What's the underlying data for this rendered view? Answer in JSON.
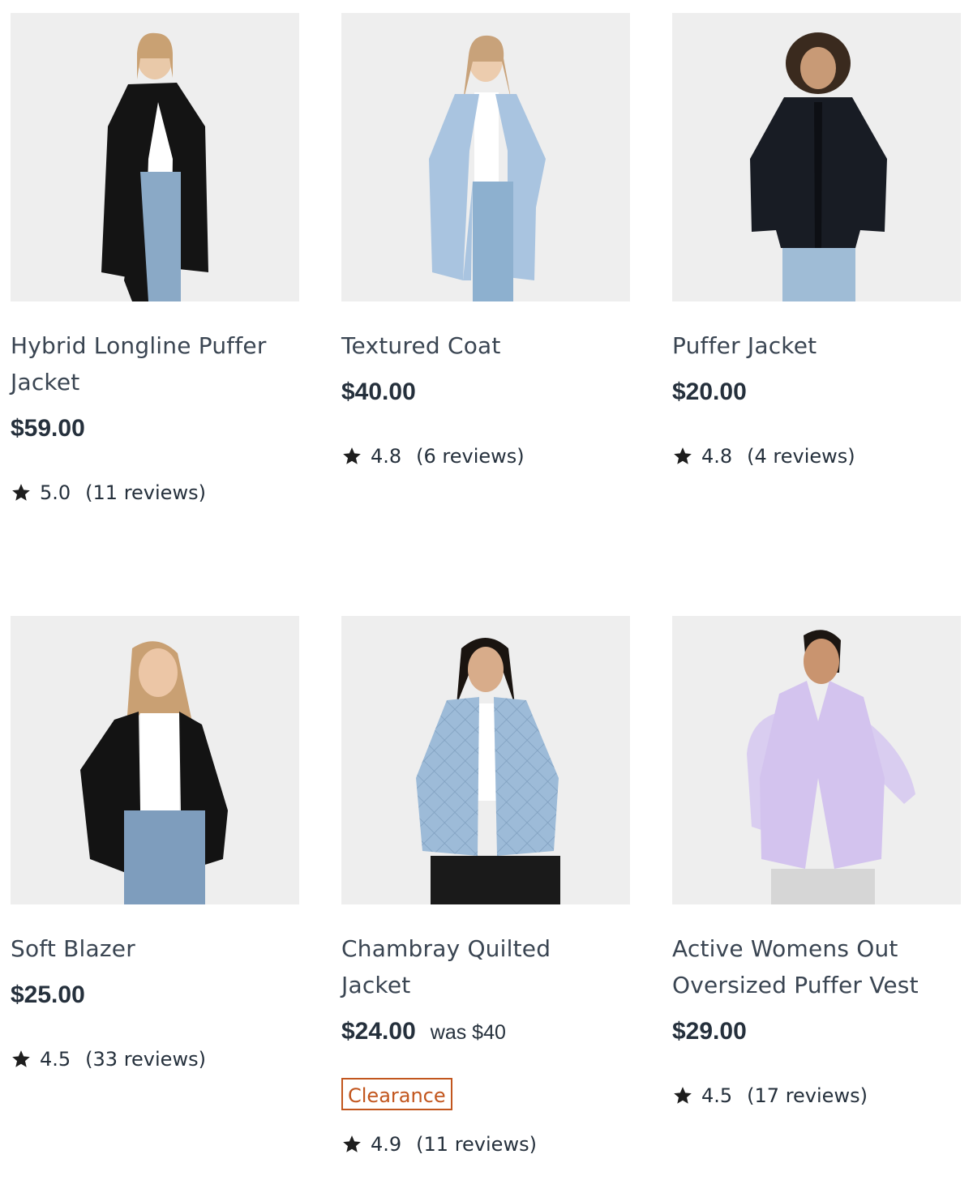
{
  "products": [
    {
      "title": "Hybrid Longline Puffer Jacket",
      "price": "$59.00",
      "rating": "5.0",
      "reviews": "(11 reviews)",
      "image": "model-black-longline-puffer"
    },
    {
      "title": "Textured Coat",
      "price": "$40.00",
      "rating": "4.8",
      "reviews": "(6 reviews)",
      "image": "model-light-blue-coat"
    },
    {
      "title": "Puffer Jacket",
      "price": "$20.00",
      "rating": "4.8",
      "reviews": "(4 reviews)",
      "image": "model-black-puffer"
    },
    {
      "title": "Soft Blazer",
      "price": "$25.00",
      "rating": "4.5",
      "reviews": "(33 reviews)",
      "image": "model-black-blazer"
    },
    {
      "title": "Chambray Quilted Jacket",
      "price": "$24.00",
      "was_price": "was $40",
      "badge": "Clearance",
      "rating": "4.9",
      "reviews": "(11 reviews)",
      "image": "model-quilted-chambray"
    },
    {
      "title": "Active Womens Out Oversized Puffer Vest",
      "price": "$29.00",
      "rating": "4.5",
      "reviews": "(17 reviews)",
      "image": "model-lilac-puffer-vest"
    }
  ],
  "colors": {
    "text": "#25303c",
    "title": "#3a4552",
    "clearance": "#c2561e",
    "image_bg": "#eeeeee"
  },
  "icons": {
    "rating": "star-icon"
  }
}
